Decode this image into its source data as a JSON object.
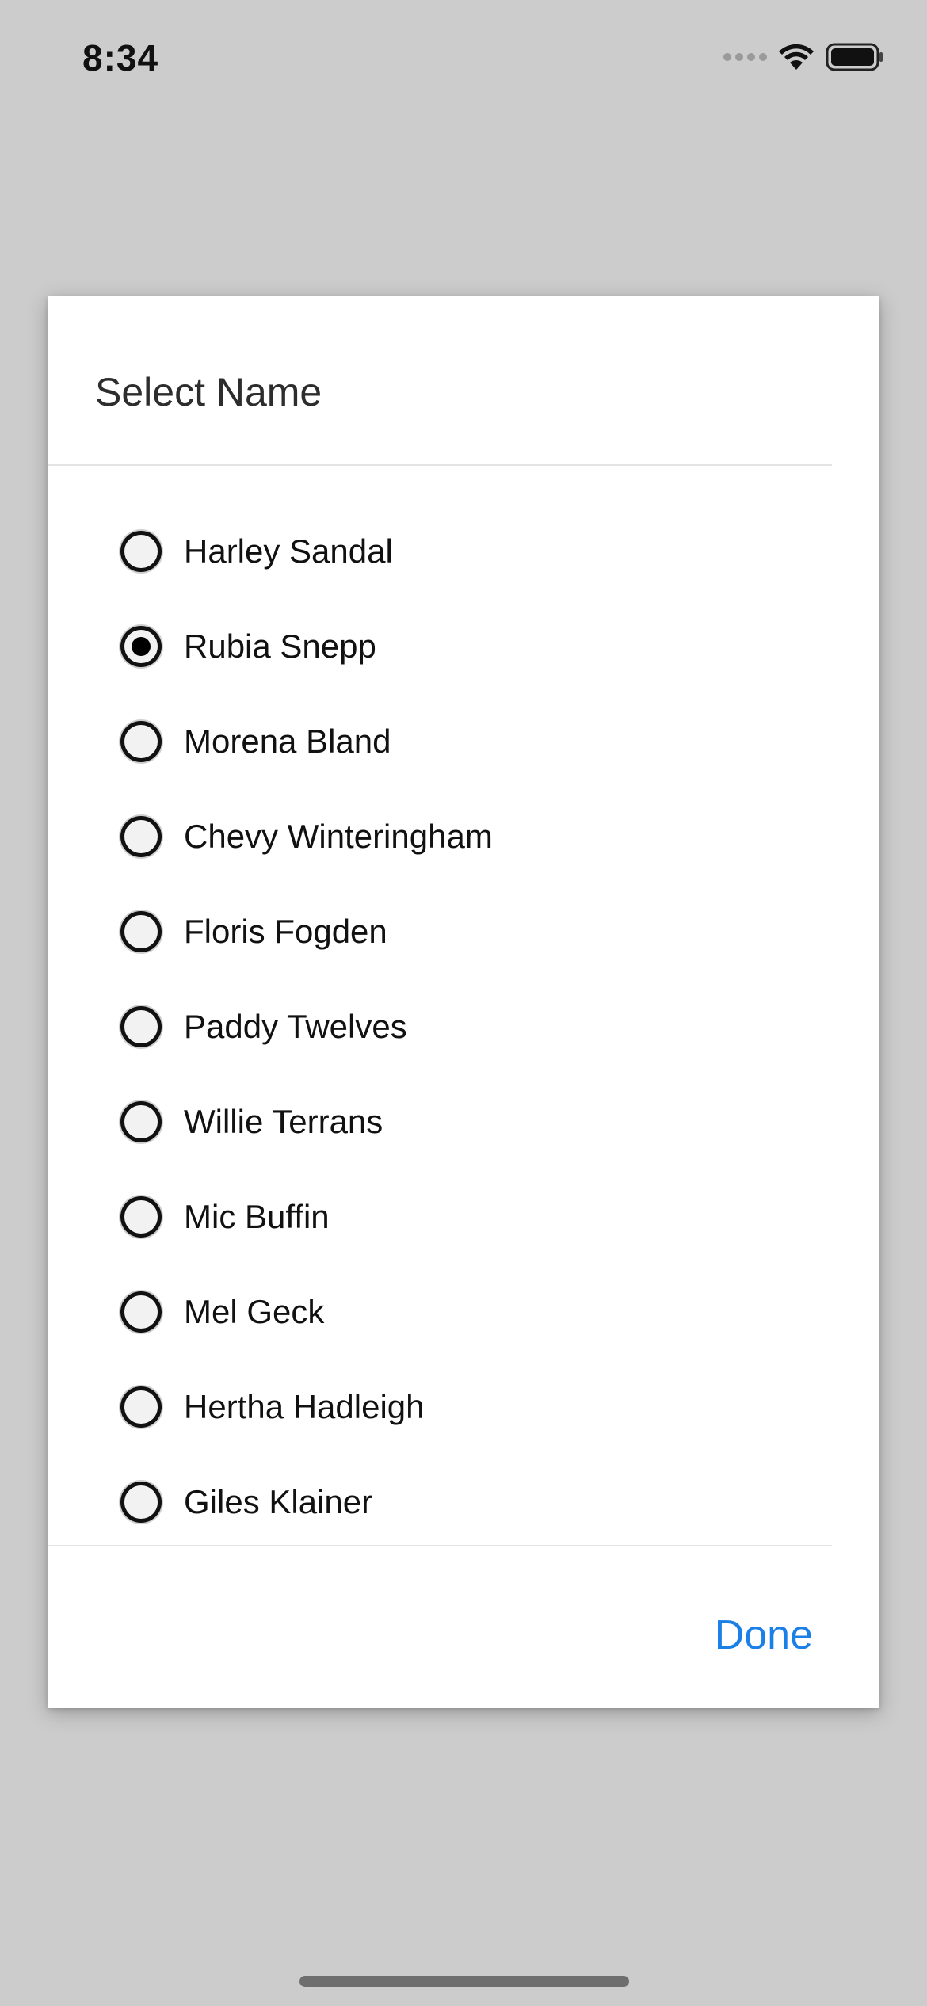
{
  "status_bar": {
    "time": "8:34",
    "icons": [
      "signal-icon",
      "wifi-icon",
      "battery-icon"
    ]
  },
  "dialog": {
    "title": "Select Name",
    "options": [
      {
        "label": "Harley Sandal",
        "selected": false
      },
      {
        "label": "Rubia Snepp",
        "selected": true
      },
      {
        "label": "Morena Bland",
        "selected": false
      },
      {
        "label": "Chevy Winteringham",
        "selected": false
      },
      {
        "label": "Floris Fogden",
        "selected": false
      },
      {
        "label": "Paddy Twelves",
        "selected": false
      },
      {
        "label": "Willie Terrans",
        "selected": false
      },
      {
        "label": "Mic Buffin",
        "selected": false
      },
      {
        "label": "Mel Geck",
        "selected": false
      },
      {
        "label": "Hertha Hadleigh",
        "selected": false
      },
      {
        "label": "Giles Klainer",
        "selected": false
      }
    ],
    "done_label": "Done"
  },
  "colors": {
    "background": "#cccccc",
    "dialog": "#ffffff",
    "accent": "#1a7fe6",
    "text": "#111111"
  }
}
